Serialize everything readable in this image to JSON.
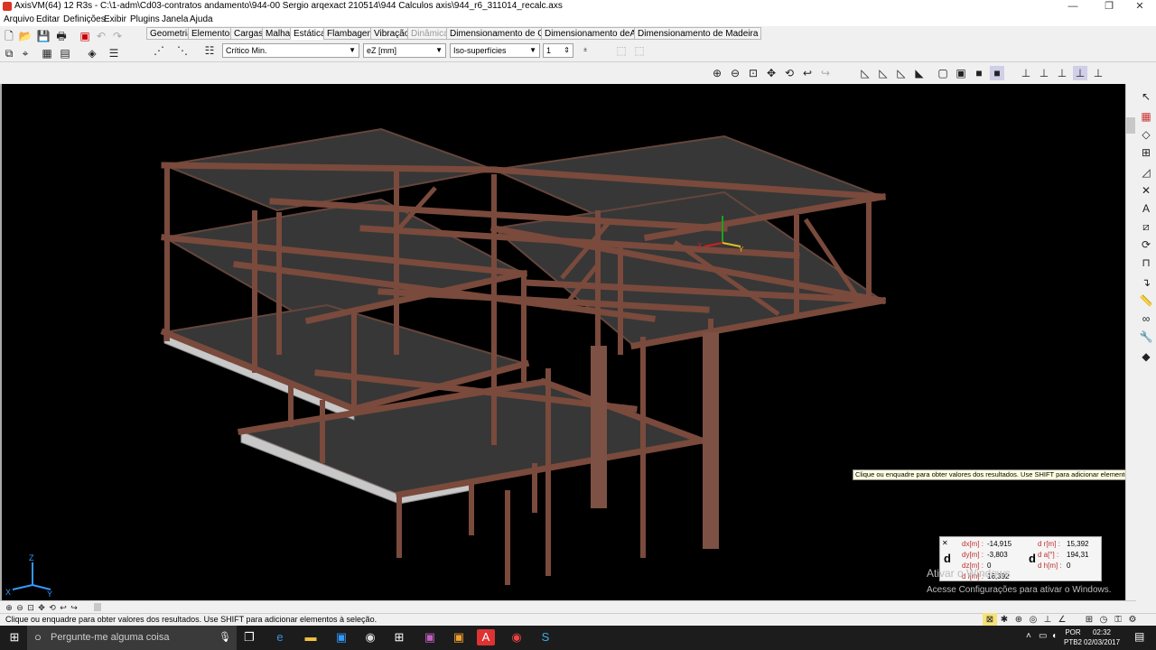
{
  "window": {
    "title": "AxisVM(64) 12 R3s - C:\\1-adm\\Cd03-contratos andamento\\944-00 Sergio arqexact 210514\\944 Calculos axis\\944_r6_311014_recalc.axs",
    "minimize": "—",
    "maximize": "❐",
    "close": "✕"
  },
  "menu": [
    "Arquivo",
    "Editar",
    "Definições",
    "Exibir",
    "Plugins",
    "Janela",
    "Ajuda"
  ],
  "tabs": [
    {
      "label": "Geometria",
      "state": "normal"
    },
    {
      "label": "Elementos",
      "state": "normal"
    },
    {
      "label": "Cargas",
      "state": "normal"
    },
    {
      "label": "Malha",
      "state": "normal"
    },
    {
      "label": "Estática",
      "state": "active"
    },
    {
      "label": "Flambagem",
      "state": "normal"
    },
    {
      "label": "Vibração",
      "state": "normal"
    },
    {
      "label": "Dinâmica",
      "state": "disabled"
    },
    {
      "label": "Dimensionamento de C.A.",
      "state": "normal"
    },
    {
      "label": "Dimensionamento deAço",
      "state": "normal"
    },
    {
      "label": "Dimensionamento de Madeira",
      "state": "normal"
    }
  ],
  "controls": {
    "load_case": "Crítico Min.",
    "component": "eZ [mm]",
    "display_mode": "Iso-superfícies",
    "scale": "1"
  },
  "tooltip": "Clique ou enquadre para obter valores dos resultados. Use SHIFT para adicionar elementos à seleção.",
  "coords": {
    "dx_label": "dx[m] :",
    "dx": "-14,915",
    "dy_label": "dy[m] :",
    "dy": "-3,803",
    "dz_label": "dz[m] :",
    "dz": "0",
    "dl_label": "d l[m] :",
    "dl": "16,392",
    "dr_label": "d r[m] :",
    "dr": "15,392",
    "da_label": "d a[°] :",
    "da": "194,31",
    "dh_label": "d h[m] :",
    "dh": "0"
  },
  "watermark": {
    "line1": "Ativar o Windows",
    "line2": "Acesse Configurações para ativar o Windows."
  },
  "status_message": "Clique ou enquadre para obter valores dos resultados. Use SHIFT para adicionar elementos à seleção.",
  "axes": {
    "x": "X",
    "y": "Y",
    "z": "Z"
  },
  "taskbar": {
    "search_placeholder": "Pergunte-me alguma coisa",
    "lang1": "POR",
    "lang2": "PTB2",
    "time": "02:32",
    "date": "02/03/2017"
  },
  "colors": {
    "viewport": "#000000",
    "frame_brown": "#6e4538",
    "slab_gray": "#4a4a4a",
    "active_tab": "#ffffff"
  }
}
